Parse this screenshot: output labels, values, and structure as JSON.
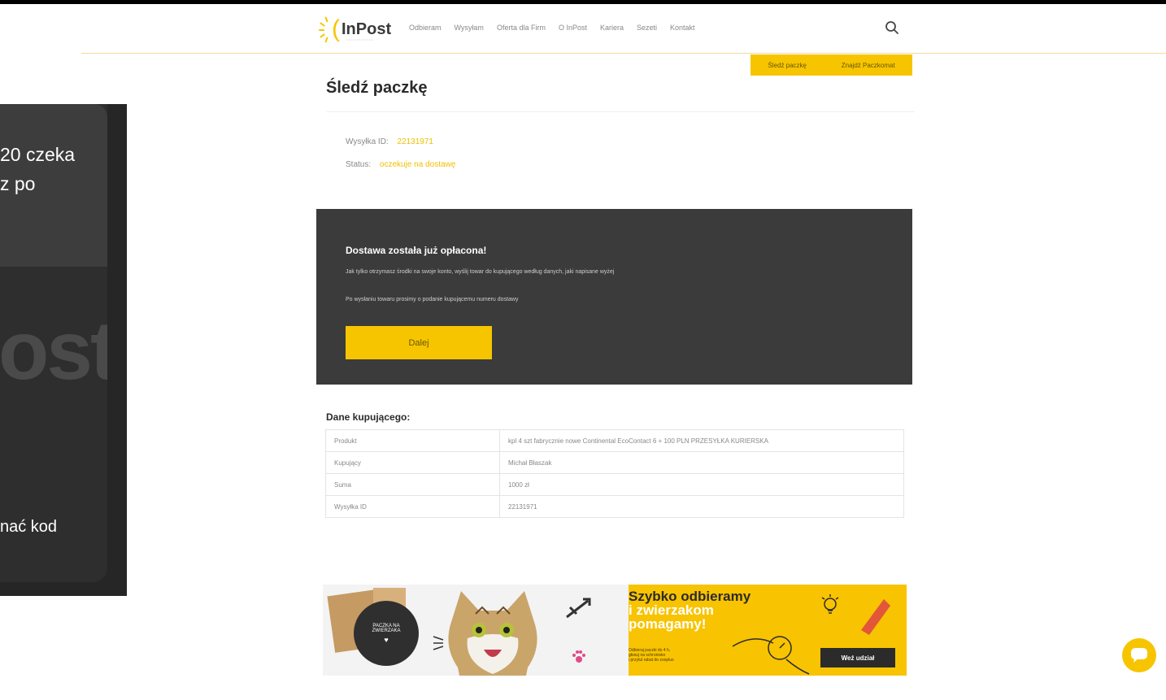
{
  "brand": {
    "logo_text": "InPost",
    "logo_sub": "· · · · · · · · · · ·"
  },
  "nav": [
    "Odbieram",
    "Wysyłam",
    "Oferta dla Firm",
    "O InPost",
    "Kariera",
    "Sezeti",
    "Kontakt"
  ],
  "top_tabs": [
    "Śledź paczkę",
    "Znajdź Paczkomat"
  ],
  "page_title": "Śledź paczkę",
  "tracking": {
    "id_label": "Wysyłka ID:",
    "id_value": "22131971",
    "status_label": "Status:",
    "status_value": "oczekuje na dostawę"
  },
  "card": {
    "title": "Dostawa została już opłacona!",
    "line1": "Jak tylko otrzymasz środki na swoje konto, wyślij towar do kupującego według danych, jaki napisane wyżej",
    "line2": "Po wysłaniu towaru prosimy o podanie kupującemu numeru dostawy",
    "button": "Dalej"
  },
  "buyer": {
    "title": "Dane kupującego:",
    "rows": [
      [
        "Produkt",
        "kpl 4 szt fabrycznie nowe Continental EcoContact 6 + 100 PLN PRZESYŁKA KURIERSKA"
      ],
      [
        "Kupujący",
        "Michał Błaszak"
      ],
      [
        "Suma",
        "1000 zł"
      ],
      [
        "Wysyłka ID",
        "22131971"
      ]
    ]
  },
  "banner": {
    "badge": [
      "PACZKA NA",
      "ZWIERZAKA"
    ],
    "heading1": "Szybko odbieramy",
    "heading2": "i zwierzakom",
    "heading3": "pomagamy!",
    "small1": "Odbieraj paczki do 4 h,",
    "small2": "głosuj na schronisko",
    "small3": "i przytul rabat do zooplus",
    "button": "Weź udział"
  },
  "overlay": {
    "text1": "20 czeka",
    "text2": "z po",
    "big": "ost",
    "bottom": "nać kod"
  },
  "colors": {
    "accent": "#f6c500",
    "dark_card": "#3b3b3b"
  }
}
